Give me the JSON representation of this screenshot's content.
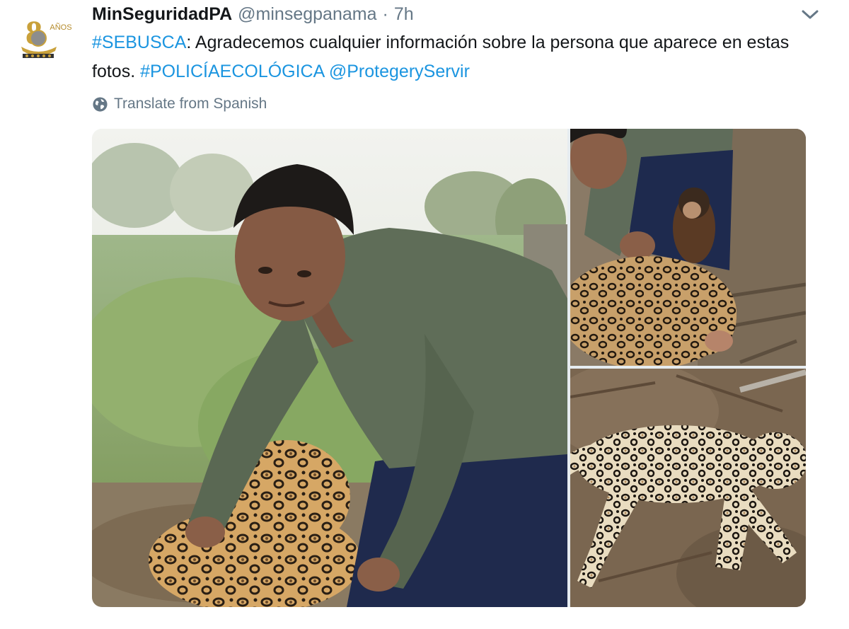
{
  "tweet": {
    "display_name": "MinSeguridadPA",
    "handle": "@minsegpanama",
    "separator": "·",
    "time": "7h",
    "text": {
      "hashtag_1": "#SEBUSCA",
      "body": ": Agradecemos cualquier información sobre la persona que aparece en estas fotos. ",
      "hashtag_2": "#POLICÍAECOLÓGICA",
      "space": " ",
      "mention": "@ProtegeryServir"
    },
    "translate_label": "Translate from Spanish"
  },
  "icons": {
    "avatar": "ministry-logo-icon",
    "menu": "chevron-down-icon",
    "translate": "globe-icon"
  },
  "colors": {
    "link": "#1b95e0",
    "muted": "#657786",
    "text": "#14171a"
  }
}
